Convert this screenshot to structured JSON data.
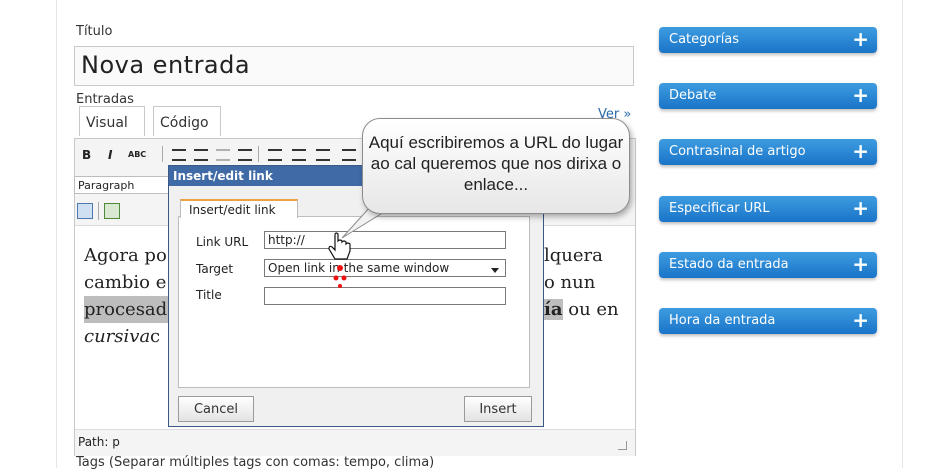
{
  "form": {
    "title_label": "Título",
    "title_value": "Nova entrada",
    "content_label": "Entradas",
    "tabs": [
      "Visual",
      "Código"
    ],
    "view_link": "Ver »",
    "format_select": "Paragraph",
    "content_lines": {
      "l1a": "Agora po",
      "l1b": "lquera",
      "l2a": "cambio e",
      "l2b": "o nun",
      "l3a": "procesad",
      "l3b": "ía",
      "l3c": " ou en",
      "l4a": "cursiva",
      "l4b": " c"
    },
    "path_label": "Path: p",
    "tags_label": "Tags (Separar múltiples tags con comas: tempo, clima)"
  },
  "toolbar": {
    "bold": "B",
    "italic": "I",
    "strike": "ABC"
  },
  "modal": {
    "title": "Insert/edit link",
    "tab": "Insert/edit link",
    "link_url_label": "Link URL",
    "link_url_value": "http://",
    "target_label": "Target",
    "target_value": "Open link in the same window",
    "title_label": "Title",
    "title_value": "",
    "cancel": "Cancel",
    "insert": "Insert"
  },
  "callout": {
    "text": "Aquí escribiremos a URL do lugar ao cal queremos que nos dirixa o enlace..."
  },
  "sidebar": {
    "items": [
      {
        "label": "Categorías"
      },
      {
        "label": "Debate"
      },
      {
        "label": "Contrasinal de artigo"
      },
      {
        "label": "Especificar URL"
      },
      {
        "label": "Estado da entrada"
      },
      {
        "label": "Hora da entrada"
      }
    ],
    "plus": "+"
  },
  "colors": {
    "sidebar_blue": "#1a74c8",
    "modal_title_blue": "#3f6aa5",
    "link_blue": "#2a6aa8"
  }
}
